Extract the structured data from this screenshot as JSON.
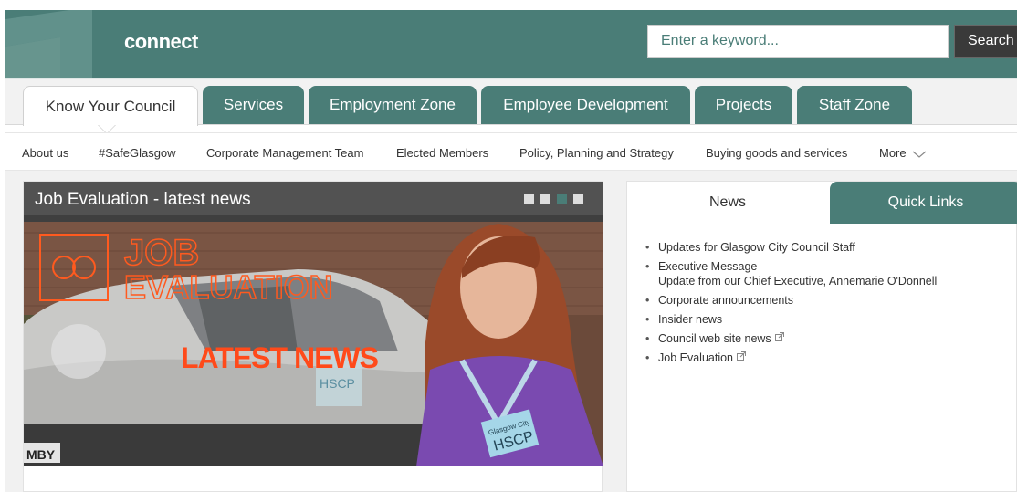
{
  "header": {
    "brand": "connect",
    "search_placeholder": "Enter a keyword...",
    "search_button": "Search",
    "icon": "logo-icon"
  },
  "main_tabs": [
    {
      "label": "Know Your Council",
      "active": true
    },
    {
      "label": "Services",
      "active": false
    },
    {
      "label": "Employment Zone",
      "active": false
    },
    {
      "label": "Employee Development",
      "active": false
    },
    {
      "label": "Projects",
      "active": false
    },
    {
      "label": "Staff Zone",
      "active": false
    }
  ],
  "subnav": {
    "items": [
      "About us",
      "#SafeGlasgow",
      "Corporate Management Team",
      "Elected Members",
      "Policy, Planning and Strategy",
      "Buying goods and services"
    ],
    "more_label": "More",
    "more_icon": "chevron-down-icon"
  },
  "feature": {
    "title": "Job Evaluation - latest news",
    "dots_total": 4,
    "active_dot": 3,
    "image_text": {
      "line1": "JOB",
      "line2": "EVALUATION",
      "line3": "LATEST NEWS",
      "badge_org": "Glasgow City",
      "badge_unit": "HSCP",
      "side_logo": "HSCP",
      "plate": "MBY"
    }
  },
  "news_panel": {
    "tabs": [
      {
        "label": "News",
        "active": true
      },
      {
        "label": "Quick Links",
        "active": false
      }
    ],
    "items": [
      {
        "title": "Updates for Glasgow City Council Staff",
        "subtitle": "",
        "external": false
      },
      {
        "title": "Executive Message",
        "subtitle": "Update from our Chief Executive, Annemarie O'Donnell",
        "external": false
      },
      {
        "title": "Corporate announcements",
        "subtitle": "",
        "external": false
      },
      {
        "title": "Insider news",
        "subtitle": "",
        "external": false
      },
      {
        "title": "Council web site news",
        "subtitle": "",
        "external": true
      },
      {
        "title": "Job Evaluation",
        "subtitle": "",
        "external": true
      }
    ]
  },
  "colors": {
    "brand_teal": "#4a7d77",
    "title_bar": "#525252",
    "accent_orange": "#ff5a1f"
  }
}
